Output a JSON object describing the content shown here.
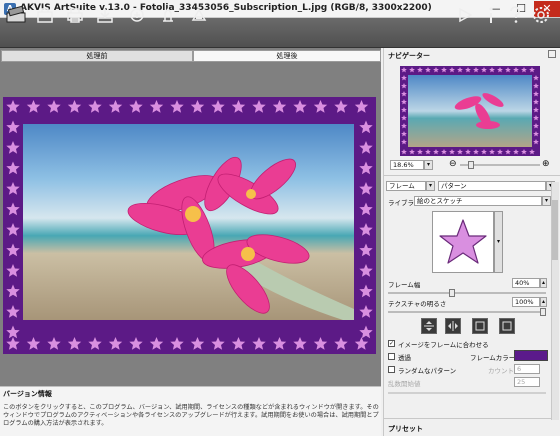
{
  "window": {
    "title": "AKVIS ArtSuite v.13.0 - Fotolia_33453056_Subscription_L.jpg (RGB/8, 3300x2200)",
    "icon": "app-icon",
    "minimize": "—",
    "maximize": "☐",
    "close": "✕"
  },
  "toolbar": {
    "left_icons": [
      "open-icon",
      "save-icon",
      "print-icon",
      "share-icon",
      "batch-icon",
      "settings-brush-icon"
    ],
    "right_icons": [
      "run-icon",
      "info-icon",
      "help-icon",
      "preferences-icon"
    ]
  },
  "tabs": {
    "before": "処理前",
    "after": "処理後"
  },
  "info_panel": {
    "title": "バージョン情報",
    "text": "このボタンをクリックすると、このプログラム、バージョン、試用期間、ライセンスの種類などが含まれるウィンドウが開きます。そのウィンドウでプログラムのアクティベーションや各ライセンスのアップグレードが行えます。試用期間をお使いの場合は、試用期間とプログラムの購入方法が表示されます。"
  },
  "navigator": {
    "title": "ナビゲーター",
    "zoom": "18.6%"
  },
  "frame": {
    "type": "フレーム",
    "style": "パターン",
    "library_label": "ライブラリ",
    "library_value": "絵のとスケッチ",
    "frame_width_label": "フレーム幅",
    "frame_width_value": "40%",
    "frame_width_level": 0.4,
    "texture_brightness_label": "テクスチャの明るさ",
    "texture_brightness_value": "100%",
    "texture_brightness_level": 1.0,
    "fit_label": "イメージをフレームに合わせる",
    "fit_checked": true,
    "transparent_label": "透過",
    "transparent_checked": false,
    "frame_color_label": "フレームカラー",
    "frame_color": "#5b1a8b",
    "random_label": "ランダムなパターン",
    "random_checked": false,
    "count_label": "カウント",
    "count_value": "6",
    "random_seed_label": "乱数開始値",
    "random_seed_value": "25"
  },
  "presets": {
    "title": "プリセット"
  },
  "colors": {
    "frame_purple": "#5c1a86",
    "star_pink": "#d98fe0",
    "toolbar": "#5a5a5a",
    "canvas_bg": "#808080"
  }
}
